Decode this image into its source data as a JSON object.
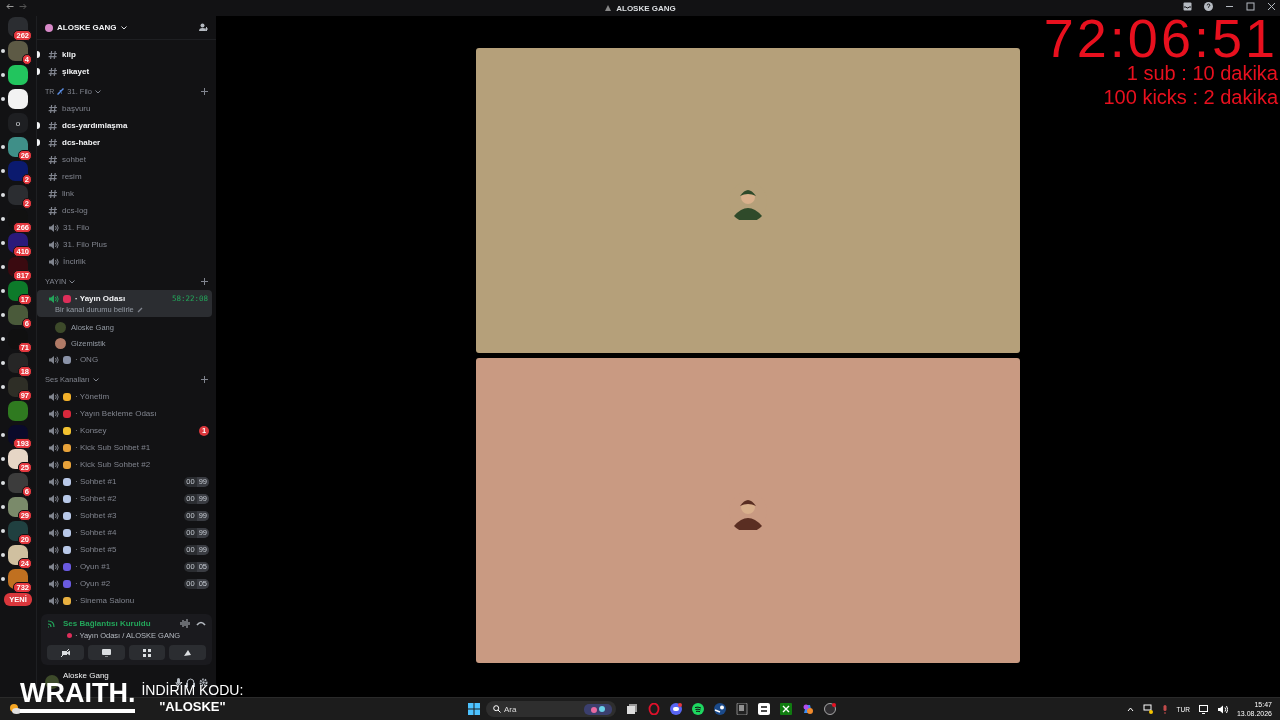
{
  "titlebar": {
    "title": "ALOSKE GANG"
  },
  "servers": [
    {
      "badge": "262",
      "color": "#2b2d31",
      "unread": false
    },
    {
      "badge": "4",
      "color": "#5d5a45",
      "unread": true
    },
    {
      "color": "#22c55e",
      "unread": true
    },
    {
      "color": "#f2f2f2",
      "unread": true
    },
    {
      "label": "o",
      "color": "#1e1f22",
      "unread": false
    },
    {
      "badge": "26",
      "color": "#3f8f88",
      "unread": true
    },
    {
      "badge": "2",
      "color": "#0b1a6e",
      "unread": true
    },
    {
      "badge": "2",
      "color": "#2b2d31",
      "unread": true
    },
    {
      "badge": "266",
      "color": "#111111",
      "unread": true
    },
    {
      "badge": "410",
      "color": "#2a1a7a",
      "unread": true
    },
    {
      "badge": "817",
      "color": "#3a0a10",
      "unread": true
    },
    {
      "badge": "17",
      "color": "#0d7a2a",
      "unread": true
    },
    {
      "badge": "6",
      "color": "#4a5a3a",
      "unread": true
    },
    {
      "badge": "71",
      "color": "#101010",
      "unread": true
    },
    {
      "badge": "18",
      "color": "#262626",
      "unread": true
    },
    {
      "badge": "97",
      "color": "#2e2e26",
      "unread": true
    },
    {
      "color": "#2f7a20",
      "unread": false
    },
    {
      "badge": "193",
      "color": "#0a0a2a",
      "unread": true
    },
    {
      "badge": "25",
      "color": "#e6d6c6",
      "unread": true
    },
    {
      "badge": "6",
      "color": "#3c3c3c",
      "unread": true
    },
    {
      "badge": "29",
      "color": "#7a8a6a",
      "unread": true
    },
    {
      "badge": "20",
      "color": "#204040",
      "unread": true
    },
    {
      "badge": "24",
      "color": "#d0c0a0",
      "unread": true
    },
    {
      "badge": "732",
      "color": "#c07020",
      "unread": true
    }
  ],
  "new_button": {
    "label": "YENİ"
  },
  "sidebar": {
    "server_name": "ALOSKE GANG",
    "sections": [
      {
        "channels": [
          {
            "kind": "text",
            "name": "klip",
            "unread": true,
            "selected": false
          },
          {
            "kind": "text",
            "name": "şikayet",
            "unread": true,
            "selected": false
          }
        ]
      },
      {
        "category": "31. Filo",
        "region": "TR",
        "channels": [
          {
            "kind": "text",
            "name": "başvuru",
            "unread": false,
            "selected": false
          },
          {
            "kind": "text",
            "name": "dcs-yardımlaşma",
            "unread": true,
            "selected": false
          },
          {
            "kind": "text",
            "name": "dcs-haber",
            "unread": true,
            "selected": false
          },
          {
            "kind": "text",
            "name": "sohbet",
            "unread": false,
            "selected": false
          },
          {
            "kind": "text",
            "name": "resim",
            "unread": false,
            "selected": false
          },
          {
            "kind": "text",
            "name": "link",
            "unread": false,
            "selected": false
          },
          {
            "kind": "text",
            "name": "dcs-log",
            "unread": false,
            "selected": false
          },
          {
            "kind": "voice",
            "name": "31. Filo",
            "unread": false,
            "selected": false
          },
          {
            "kind": "voice",
            "name": "31. Filo Plus",
            "unread": false,
            "selected": false
          },
          {
            "kind": "voice",
            "name": "İncirlik",
            "unread": false,
            "selected": false
          }
        ]
      },
      {
        "category": "YAYIN",
        "channels": [
          {
            "kind": "voice",
            "name": "· Yayın Odası",
            "color": "#dd2e5a",
            "unread": true,
            "selected": true,
            "time": "58:22:08",
            "status": "Bir kanal durumu belirle",
            "members": [
              {
                "name": "Aloske Gang",
                "color": "#3d4a2a"
              },
              {
                "name": "Gizemistik",
                "color": "#b07a66"
              }
            ]
          },
          {
            "kind": "voice",
            "name": "· ONG",
            "color": "#8a93a8",
            "unread": false,
            "selected": false
          }
        ]
      },
      {
        "category": "Ses Kanalları",
        "channels": [
          {
            "kind": "voice",
            "name": "· Yönetim",
            "color": "#f2b02a",
            "unread": false,
            "selected": false
          },
          {
            "kind": "voice",
            "name": "· Yayın Bekleme Odası",
            "color": "#d8283c",
            "unread": false,
            "selected": false
          },
          {
            "kind": "voice",
            "name": "· Konsey",
            "color": "#f2c230",
            "unread": false,
            "selected": false,
            "mention": "1"
          },
          {
            "kind": "voice",
            "name": "· Kick Sub Sohbet #1",
            "color": "#e8a23a",
            "unread": false,
            "selected": false
          },
          {
            "kind": "voice",
            "name": "· Kick Sub Sohbet #2",
            "color": "#e8a23a",
            "unread": false,
            "selected": false
          },
          {
            "kind": "voice",
            "name": "· Sohbet #1",
            "color": "#b8c8e8",
            "unread": false,
            "selected": false,
            "limit": [
              "00",
              "99"
            ]
          },
          {
            "kind": "voice",
            "name": "· Sohbet #2",
            "color": "#b8c8e8",
            "unread": false,
            "selected": false,
            "limit": [
              "00",
              "99"
            ]
          },
          {
            "kind": "voice",
            "name": "· Sohbet #3",
            "color": "#b8c8e8",
            "unread": false,
            "selected": false,
            "limit": [
              "00",
              "99"
            ]
          },
          {
            "kind": "voice",
            "name": "· Sohbet #4",
            "color": "#b8c8e8",
            "unread": false,
            "selected": false,
            "limit": [
              "00",
              "99"
            ]
          },
          {
            "kind": "voice",
            "name": "· Sohbet #5",
            "color": "#b8c8e8",
            "unread": false,
            "selected": false,
            "limit": [
              "00",
              "99"
            ]
          },
          {
            "kind": "voice",
            "name": "· Oyun #1",
            "color": "#6a5ae0",
            "unread": false,
            "selected": false,
            "limit": [
              "00",
              "05"
            ]
          },
          {
            "kind": "voice",
            "name": "· Oyun #2",
            "color": "#6a5ae0",
            "unread": false,
            "selected": false,
            "limit": [
              "00",
              "05"
            ]
          },
          {
            "kind": "voice",
            "name": "· Sinema Salonu",
            "color": "#e8b040",
            "unread": false,
            "selected": false
          }
        ]
      }
    ]
  },
  "voice_panel": {
    "status": "Ses Bağlantısı Kuruldu",
    "location": "· Yayın Odası / ALOSKE GANG"
  },
  "user_panel": {
    "name": "Aloske Gang"
  },
  "stage": {
    "tiles": [
      {
        "color": "#b5a07a"
      },
      {
        "color": "#c99a82"
      }
    ]
  },
  "timer_overlay": {
    "time": "72:06:51",
    "lines": [
      "1 sub : 10 dakika",
      "100 kicks : 2 dakika"
    ]
  },
  "promo_overlay": {
    "brand": "WRAITH.",
    "lines": [
      "İNDİRİM KODU:",
      "\"ALOSKE\""
    ]
  },
  "taskbar": {
    "search_placeholder": "Ara",
    "language": "TUR",
    "time": "15:47",
    "date": "13.08.2026"
  }
}
